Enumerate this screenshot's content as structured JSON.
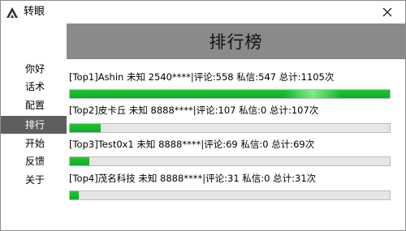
{
  "window": {
    "title": "转眼",
    "close_glyph": "✕"
  },
  "sidebar": {
    "items": [
      {
        "label": "你好"
      },
      {
        "label": "话术"
      },
      {
        "label": "配置"
      },
      {
        "label": "排行"
      },
      {
        "label": "开始"
      },
      {
        "label": "反馈"
      },
      {
        "label": "关于"
      }
    ],
    "active_index": 3
  },
  "header": {
    "title": "排行榜"
  },
  "ranking": [
    {
      "label": "[Top1]Ashin 未知 2540****|评论:558 私信:547 总计:1105次",
      "progress": 1.0
    },
    {
      "label": "[Top2]皮卡丘 未知 8888****|评论:107 私信:0 总计:107次",
      "progress": 0.097
    },
    {
      "label": "[Top3]Test0x1 未知 8888****|评论:69 私信:0 总计:69次",
      "progress": 0.062
    },
    {
      "label": "[Top4]茂名科技 未知 8888****|评论:31 私信:0 总计:31次",
      "progress": 0.028
    }
  ],
  "colors": {
    "progress_fill": "#06b025",
    "header_band": "#8a8a8a",
    "active_nav": "#5e5e5e"
  },
  "icons": {
    "app": "app-logo-icon",
    "close": "close-icon"
  }
}
